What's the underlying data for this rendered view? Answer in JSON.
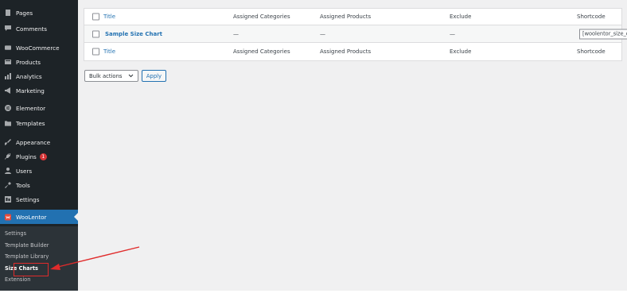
{
  "sidebar": {
    "items": [
      {
        "label": "Pages",
        "icon": "pages-icon"
      },
      {
        "label": "Comments",
        "icon": "comments-icon"
      },
      {
        "label": "WooCommerce",
        "icon": "woocommerce-icon"
      },
      {
        "label": "Products",
        "icon": "products-icon"
      },
      {
        "label": "Analytics",
        "icon": "analytics-icon"
      },
      {
        "label": "Marketing",
        "icon": "marketing-icon"
      },
      {
        "label": "Elementor",
        "icon": "elementor-icon"
      },
      {
        "label": "Templates",
        "icon": "templates-icon"
      },
      {
        "label": "Appearance",
        "icon": "appearance-icon"
      },
      {
        "label": "Plugins",
        "icon": "plugins-icon",
        "badge": "1"
      },
      {
        "label": "Users",
        "icon": "users-icon"
      },
      {
        "label": "Tools",
        "icon": "tools-icon"
      },
      {
        "label": "Settings",
        "icon": "settings-icon"
      },
      {
        "label": "WooLentor",
        "icon": "woolentor-icon",
        "active": true
      }
    ],
    "submenu": [
      {
        "label": "Settings"
      },
      {
        "label": "Template Builder"
      },
      {
        "label": "Template Library"
      },
      {
        "label": "Size Charts",
        "current": true
      },
      {
        "label": "Extension"
      }
    ]
  },
  "table": {
    "columns": [
      "Title",
      "Assigned Categories",
      "Assigned Products",
      "Exclude",
      "Shortcode"
    ],
    "rows": [
      {
        "title": "Sample Size Chart",
        "categories": "—",
        "products": "—",
        "exclude": "—",
        "shortcode": "[woolentor_size_chart"
      }
    ]
  },
  "bulk_actions": {
    "selected": "Bulk actions",
    "apply_label": "Apply"
  },
  "colors": {
    "sidebar_bg": "#1d2327",
    "accent": "#2271b1",
    "annotation": "#e02b2b",
    "badge": "#d63638"
  }
}
